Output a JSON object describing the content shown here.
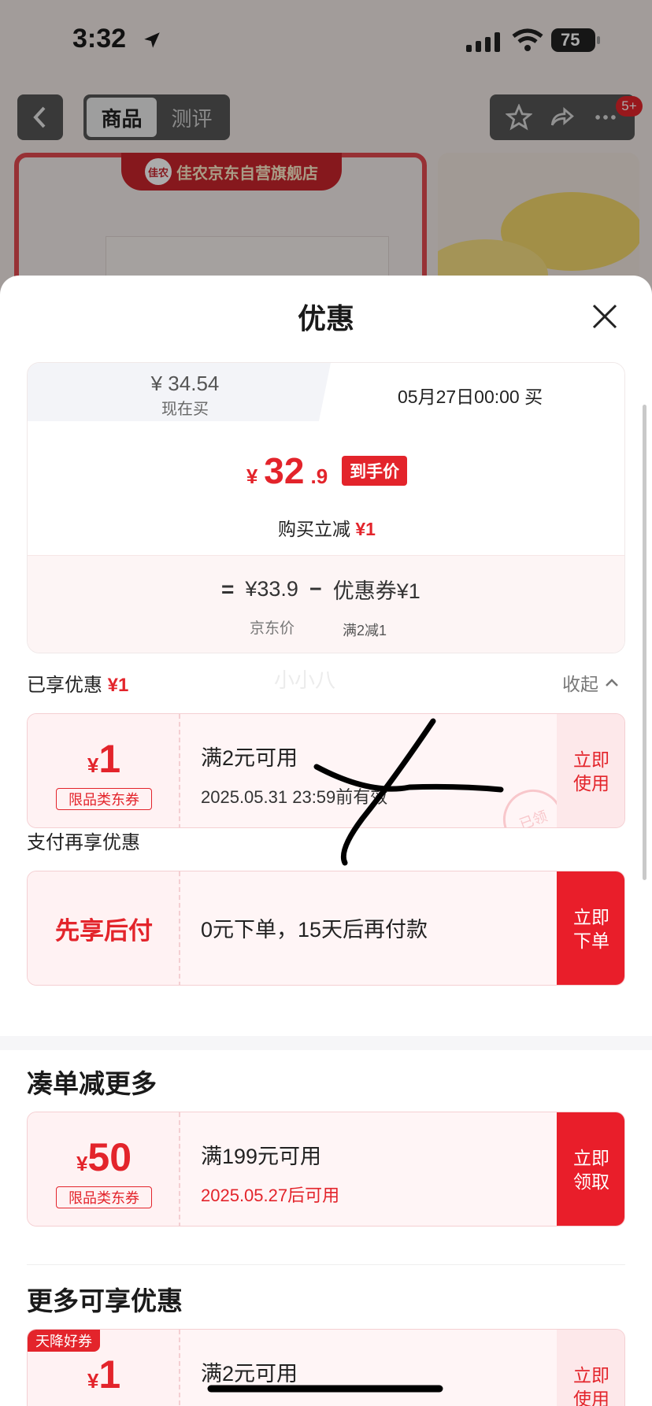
{
  "status_bar": {
    "time": "3:32",
    "battery": "75"
  },
  "nav": {
    "tabs": [
      "商品",
      "测评"
    ],
    "badge": "5+"
  },
  "shop": {
    "logo": "佳农",
    "name": "佳农京东自营旗舰店"
  },
  "sheet": {
    "title": "优惠",
    "price_card": {
      "now_price": "¥ 34.54",
      "now_label": "现在买",
      "future_time": "05月27日00:00 买",
      "final_currency": "¥",
      "final_int": "32",
      "final_dec": ".9",
      "final_tag": "到手价",
      "reduce_text": "购买立减",
      "reduce_value": "¥1",
      "formula_eq": "=",
      "jd_price": "¥33.9",
      "formula_minus": "−",
      "coupon_part": "优惠券¥1",
      "jd_label": "京东价",
      "coupon_rule": "满2减1"
    },
    "enjoyed_label": "已享优惠",
    "enjoyed_value": "¥1",
    "watermark": "小小八",
    "collapse": "收起",
    "enjoyed_coupon": {
      "currency": "¥",
      "value": "1",
      "type": "限品类东券",
      "condition": "满2元可用",
      "expiry": "2025.05.31 23:59前有效",
      "button": "立即使用",
      "stamp": "已领"
    },
    "pay_section": "支付再享优惠",
    "pay_offer": {
      "name": "先享后付",
      "desc": "0元下单，15天后再付款",
      "button": "立即下单"
    },
    "bundle_section": "凑单减更多",
    "bundle_coupon": {
      "currency": "¥",
      "value": "50",
      "type": "限品类东券",
      "condition": "满199元可用",
      "expiry": "2025.05.27后可用",
      "button": "立即领取"
    },
    "more_section": "更多可享优惠",
    "more_coupon": {
      "ribbon": "天降好券",
      "currency": "¥",
      "value": "1",
      "condition": "满2元可用",
      "button": "立即使用"
    }
  },
  "colors": {
    "accent": "#e3242b",
    "button": "#e91e2a",
    "coupon_bg": "#fff5f6"
  }
}
